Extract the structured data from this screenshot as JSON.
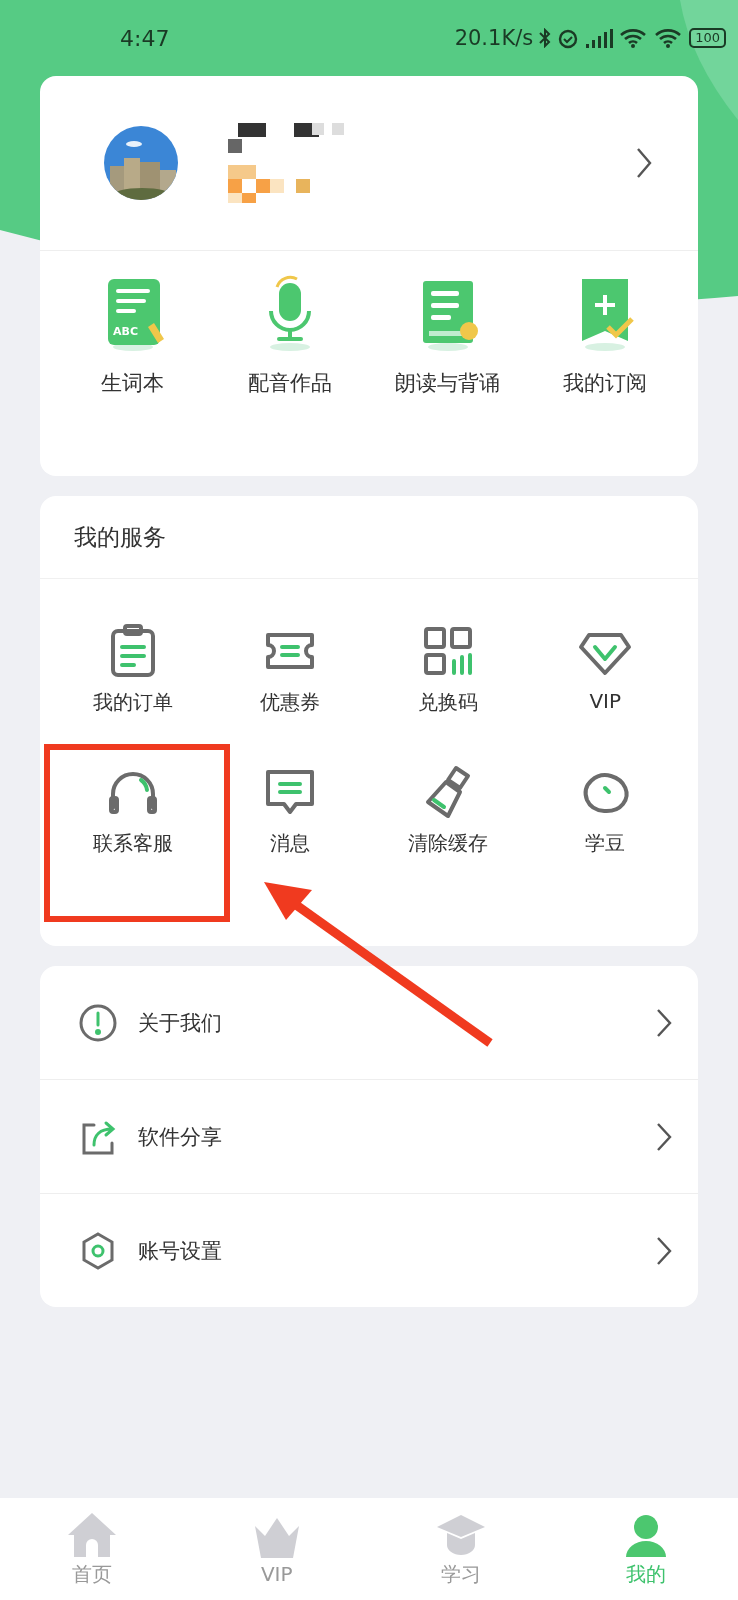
{
  "status_bar": {
    "time": "4:47",
    "speed": "20.1K/s",
    "battery": "100"
  },
  "profile": {
    "shortcuts": [
      {
        "kind": "wordbook",
        "label": "生词本",
        "icon_text": "ABC"
      },
      {
        "kind": "mic",
        "label": "配音作品"
      },
      {
        "kind": "book",
        "label": "朗读与背诵"
      },
      {
        "kind": "subscribe",
        "label": "我的订阅"
      }
    ]
  },
  "services": {
    "title": "我的服务",
    "items": [
      {
        "kind": "order",
        "label": "我的订单"
      },
      {
        "kind": "coupon",
        "label": "优惠券"
      },
      {
        "kind": "code",
        "label": "兑换码"
      },
      {
        "kind": "vip",
        "label": "VIP"
      },
      {
        "kind": "headset",
        "label": "联系客服"
      },
      {
        "kind": "message",
        "label": "消息"
      },
      {
        "kind": "brush",
        "label": "清除缓存"
      },
      {
        "kind": "bean",
        "label": "学豆"
      }
    ]
  },
  "menu": [
    {
      "kind": "info",
      "label": "关于我们"
    },
    {
      "kind": "share",
      "label": "软件分享"
    },
    {
      "kind": "settings",
      "label": "账号设置"
    }
  ],
  "tab_bar": [
    {
      "kind": "home",
      "label": "首页",
      "selected": false
    },
    {
      "kind": "crown",
      "label": "VIP",
      "selected": false
    },
    {
      "kind": "cap",
      "label": "学习",
      "selected": false
    },
    {
      "kind": "me",
      "label": "我的",
      "selected": true
    }
  ]
}
